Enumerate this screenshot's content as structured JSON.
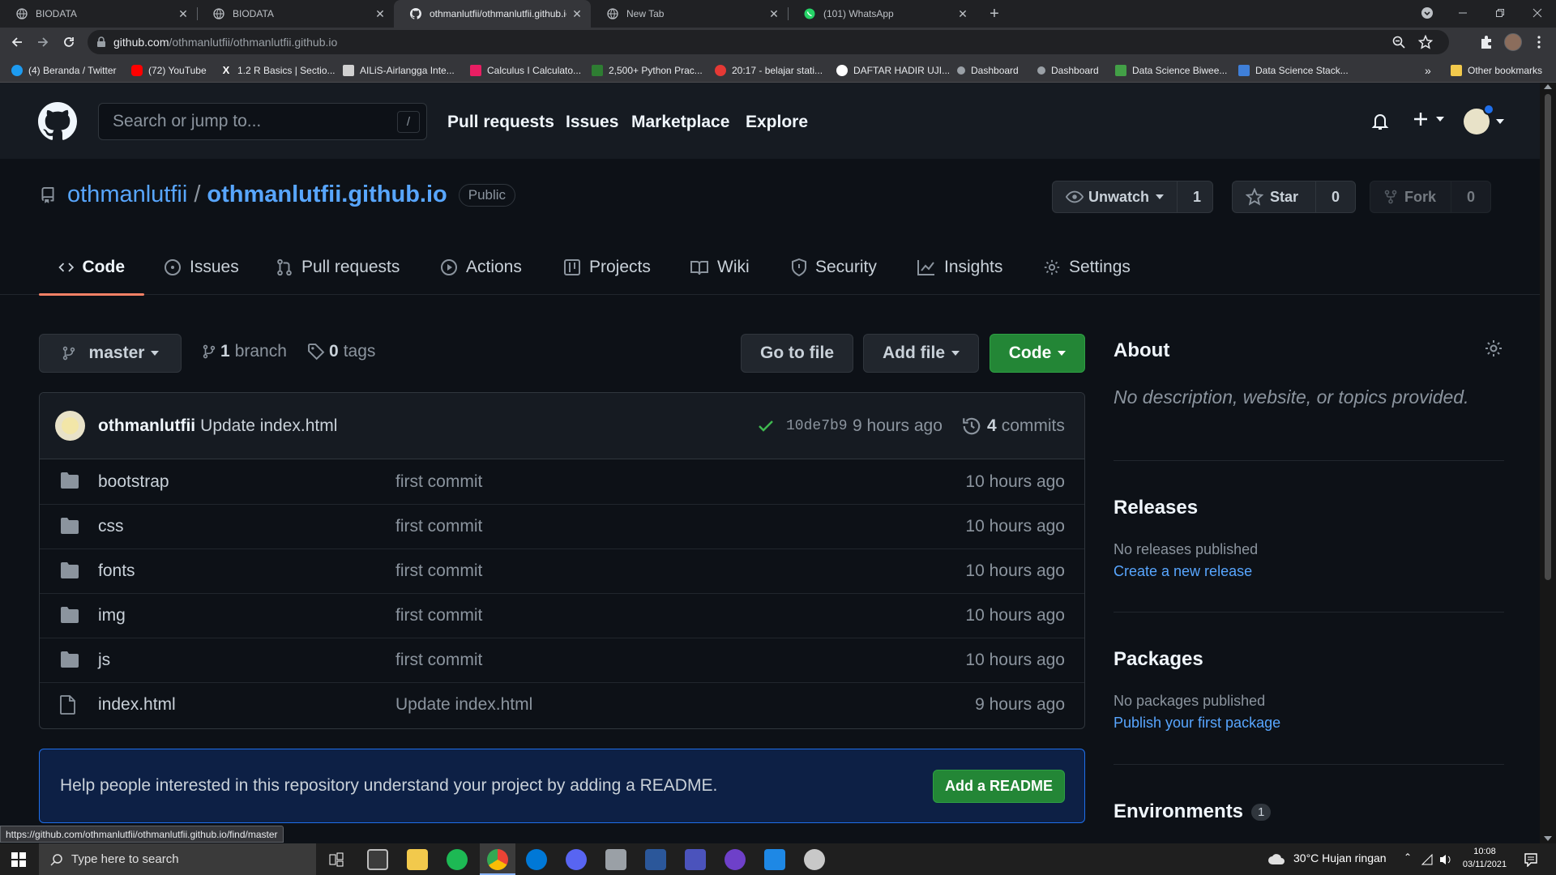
{
  "browser": {
    "tabs": [
      {
        "title": "BIODATA",
        "active": false
      },
      {
        "title": "BIODATA",
        "active": false
      },
      {
        "title": "othmanlutfii/othmanlutfii.github.io",
        "active": true
      },
      {
        "title": "New Tab",
        "active": false
      },
      {
        "title": "(101) WhatsApp",
        "active": false
      }
    ],
    "url_host": "github.com",
    "url_path": "/othmanlutfii/othmanlutfii.github.io",
    "bookmarks": [
      {
        "label": "(4) Beranda / Twitter",
        "color": "#1d9bf0"
      },
      {
        "label": "(72) YouTube",
        "color": "#ff0000"
      },
      {
        "label": "1.2 R Basics | Sectio...",
        "color": "#ffffff"
      },
      {
        "label": "AILiS-Airlangga Inte...",
        "color": "#d0d0d0"
      },
      {
        "label": "Calculus I Calculato...",
        "color": "#e91e63"
      },
      {
        "label": "2,500+ Python Prac...",
        "color": "#2e7d32"
      },
      {
        "label": "20:17 - belajar stati...",
        "color": "#e53935"
      },
      {
        "label": "DAFTAR HADIR UJI...",
        "color": "#ffffff"
      },
      {
        "label": "Dashboard",
        "color": "#9aa0a6"
      },
      {
        "label": "Dashboard",
        "color": "#9aa0a6"
      },
      {
        "label": "Data Science Biwee...",
        "color": "#43a047"
      },
      {
        "label": "Data Science Stack...",
        "color": "#3f7fd8"
      }
    ],
    "bookmarks_more": "»",
    "other_bookmarks": "Other bookmarks",
    "status_url": "https://github.com/othmanlutfii/othmanlutfii.github.io/find/master"
  },
  "github": {
    "search_placeholder": "Search or jump to...",
    "search_shortcut": "/",
    "nav": [
      "Pull requests",
      "Issues",
      "Marketplace",
      "Explore"
    ],
    "owner": "othmanlutfii",
    "repo": "othmanlutfii.github.io",
    "visibility": "Public",
    "unwatch_label": "Unwatch",
    "watch_count": "1",
    "star_label": "Star",
    "star_count": "0",
    "fork_label": "Fork",
    "fork_count": "0",
    "repo_tabs": [
      "Code",
      "Issues",
      "Pull requests",
      "Actions",
      "Projects",
      "Wiki",
      "Security",
      "Insights",
      "Settings"
    ],
    "branch": "master",
    "branch_count": "1",
    "branch_label": "branch",
    "tag_count": "0",
    "tag_label": "tags",
    "go_to_file": "Go to file",
    "add_file": "Add file",
    "code_button": "Code",
    "commit": {
      "author": "othmanlutfii",
      "message": "Update index.html",
      "sha": "10de7b9",
      "time": "9 hours ago",
      "count": "4",
      "count_label": "commits"
    },
    "files": [
      {
        "name": "bootstrap",
        "type": "folder",
        "message": "first commit",
        "age": "10 hours ago"
      },
      {
        "name": "css",
        "type": "folder",
        "message": "first commit",
        "age": "10 hours ago"
      },
      {
        "name": "fonts",
        "type": "folder",
        "message": "first commit",
        "age": "10 hours ago"
      },
      {
        "name": "img",
        "type": "folder",
        "message": "first commit",
        "age": "10 hours ago"
      },
      {
        "name": "js",
        "type": "folder",
        "message": "first commit",
        "age": "10 hours ago"
      },
      {
        "name": "index.html",
        "type": "file",
        "message": "Update index.html",
        "age": "9 hours ago"
      }
    ],
    "readme_prompt": "Help people interested in this repository understand your project by adding a README.",
    "add_readme": "Add a README",
    "about": {
      "title": "About",
      "description": "No description, website, or topics provided."
    },
    "releases": {
      "title": "Releases",
      "text": "No releases published",
      "link": "Create a new release"
    },
    "packages": {
      "title": "Packages",
      "text": "No packages published",
      "link": "Publish your first package"
    },
    "environments": {
      "title": "Environments",
      "count": "1"
    }
  },
  "taskbar": {
    "search_placeholder": "Type here to search",
    "weather": "30°C  Hujan ringan",
    "time": "10:08",
    "date": "03/11/2021"
  }
}
